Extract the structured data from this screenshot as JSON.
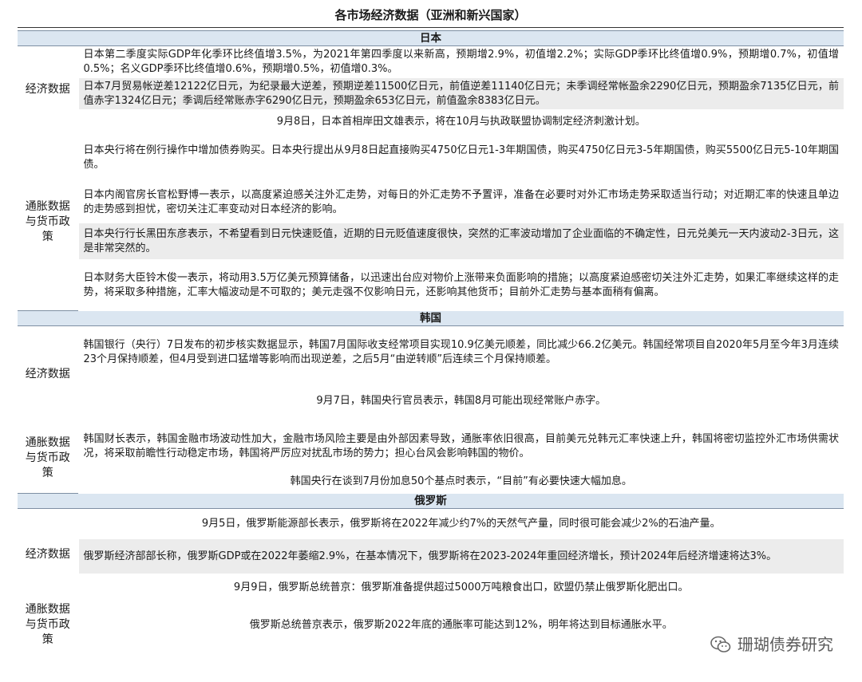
{
  "title": "各市场经济数据（亚洲和新兴国家）",
  "labels": {
    "econ": "经济数据",
    "policy": "通胀数据与货币政策"
  },
  "sections": {
    "japan": {
      "name": "日本",
      "econ": [
        "日本第二季度实际GDP年化季环比终值增3.5%，为2021年第四季度以来新高，预期增2.9%，初值增2.2%；实际GDP季环比终值增0.9%，预期增0.7%，初值增0.5%；名义GDP季环比终值增0.6%，预期增0.5%，初值增0.3%。",
        "日本7月贸易帐逆差12122亿日元，为纪录最大逆差，预期逆差11500亿日元，前值逆差11140亿日元；未季调经常帐盈余2290亿日元，预期盈余7135亿日元，前值赤字1324亿日元；季调后经常账赤字6290亿日元，预期盈余653亿日元，前值盈余8383亿日元。",
        "9月8日，日本首相岸田文雄表示，将在10月与执政联盟协调制定经济刺激计划。"
      ],
      "policy": [
        "日本央行将在例行操作中增加债券购买。日本央行提出从9月8日起直接购买4750亿日元1-3年期国债，购买4750亿日元3-5年期国债，购买5500亿日元5-10年期国债。",
        "日本内阁官房长官松野博一表示，以高度紧迫感关注外汇走势，对每日的外汇走势不予置评，准备在必要时对外汇市场走势采取适当行动；对近期汇率的快速且单边的走势感到担忧，密切关注汇率变动对日本经济的影响。",
        "日本央行行长黑田东彦表示，不希望看到日元快速贬值，近期的日元贬值速度很快，突然的汇率波动增加了企业面临的不确定性，日元兑美元一天内波动2-3日元，这是非常突然的。",
        "日本财务大臣铃木俊一表示，将动用3.5万亿美元预算储备，以迅速出台应对物价上涨带来负面影响的措施；以高度紧迫感密切关注外汇走势，如果汇率继续这样的走势，将采取多种措施，汇率大幅波动是不可取的；美元走强不仅影响日元，还影响其他货币；目前外汇走势与基本面稍有偏离。"
      ]
    },
    "korea": {
      "name": "韩国",
      "econ": [
        "韩国银行（央行）7日发布的初步核实数据显示，韩国7月国际收支经常项目实现10.9亿美元顺差，同比减少66.2亿美元。韩国经常项目自2020年5月至今年3月连续23个月保持顺差，但4月受到进口猛增等影响而出现逆差，之后5月“由逆转顺”后连续三个月保持顺差。",
        "9月7日，韩国央行官员表示，韩国8月可能出现经常账户赤字。"
      ],
      "policy": [
        "韩国财长表示，韩国金融市场波动性加大，金融市场风险主要是由外部因素导致，通胀率依旧很高，目前美元兑韩元汇率快速上升，韩国将密切监控外汇市场供需状况，将采取前瞻性行动稳定市场，韩国将严厉应对扰乱市场的势力；担心台风会影响韩国的物价。",
        "韩国央行在谈到7月份加息50个基点时表示，“目前”有必要快速大幅加息。"
      ]
    },
    "russia": {
      "name": "俄罗斯",
      "econ": [
        "9月5日，俄罗斯能源部长表示，俄罗斯将在2022年减少约7%的天然气产量，同时很可能会减少2%的石油产量。",
        "俄罗斯经济部部长称，俄罗斯GDP或在2022年萎缩2.9%，在基本情况下，俄罗斯将在2023-2024年重回经济增长，预计2024年后经济增速将达3%。",
        "9月9日，俄罗斯总统普京：俄罗斯准备提供超过5000万吨粮食出口，欧盟仍禁止俄罗斯化肥出口。"
      ],
      "policy": [
        "俄罗斯总统普京表示，俄罗斯2022年底的通胀率可能达到12%，明年将达到目标通胀水平。"
      ]
    }
  },
  "watermark": {
    "icon": "wechat-icon",
    "text": "珊瑚债券研究"
  }
}
